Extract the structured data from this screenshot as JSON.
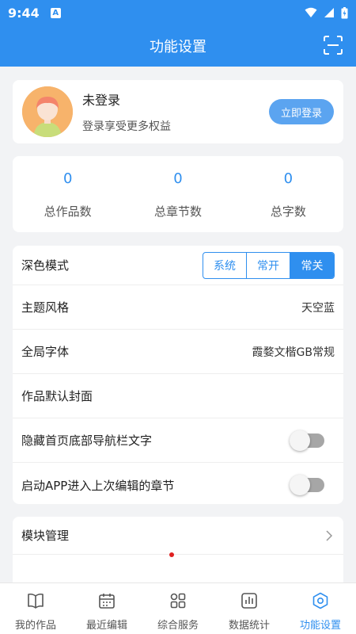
{
  "status_bar": {
    "time": "9:44",
    "badge": "A"
  },
  "header": {
    "title": "功能设置",
    "scan_icon": "scan-icon"
  },
  "profile": {
    "name": "未登录",
    "subtitle": "登录享受更多权益",
    "login_button": "立即登录"
  },
  "stats": [
    {
      "value": "0",
      "label": "总作品数"
    },
    {
      "value": "0",
      "label": "总章节数"
    },
    {
      "value": "0",
      "label": "总字数"
    }
  ],
  "settings": {
    "dark_mode": {
      "label": "深色模式",
      "options": [
        "系统",
        "常开",
        "常关"
      ],
      "selected": "常关"
    },
    "theme": {
      "label": "主题风格",
      "value": "天空蓝"
    },
    "font": {
      "label": "全局字体",
      "value": "霞婺文楷GB常规"
    },
    "cover": {
      "label": "作品默认封面"
    },
    "hide_nav_text": {
      "label": "隐藏首页底部导航栏文字",
      "on": false
    },
    "resume_chapter": {
      "label": "启动APP进入上次编辑的章节",
      "on": false
    }
  },
  "modules": {
    "label": "模块管理"
  },
  "tabs": [
    {
      "label": "我的作品",
      "icon": "book-icon",
      "active": false
    },
    {
      "label": "最近编辑",
      "icon": "calendar-icon",
      "active": false
    },
    {
      "label": "综合服务",
      "icon": "grid-icon",
      "active": false
    },
    {
      "label": "数据统计",
      "icon": "chart-icon",
      "active": false
    },
    {
      "label": "功能设置",
      "icon": "gear-icon",
      "active": true
    }
  ],
  "colors": {
    "primary": "#2f8fef",
    "button": "#5ba4f0",
    "background": "#f2f3f5"
  }
}
